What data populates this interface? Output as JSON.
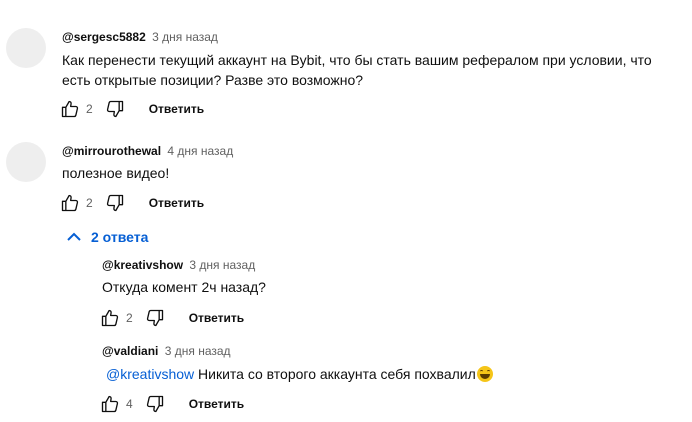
{
  "comments": [
    {
      "author": "@sergesc5882",
      "time": "3 дня назад",
      "text_line1": "Как перенести текущий  аккаунт на Bybit,  что бы стать вашим рефералом  при условии, что",
      "text_line2": "есть открытые позиции?   Разве это возможно?",
      "likes": "2",
      "reply_label": "Ответить"
    },
    {
      "author": "@mirrourothewal",
      "time": "4 дня назад",
      "text_line1": "полезное видео!",
      "likes": "2",
      "reply_label": "Ответить",
      "replies_toggle": "2 ответа",
      "replies": [
        {
          "author": "@kreativshow",
          "time": "3 дня назад",
          "text": "Откуда комент 2ч назад?",
          "likes": "2",
          "reply_label": "Ответить"
        },
        {
          "author": "@valdiani",
          "time": "3 дня назад",
          "mention": "@kreativshow",
          "text": " Никита со второго аккаунта себя похвалил",
          "emoji": "grinning-sweat-emoji",
          "likes": "4",
          "reply_label": "Ответить"
        }
      ]
    }
  ]
}
